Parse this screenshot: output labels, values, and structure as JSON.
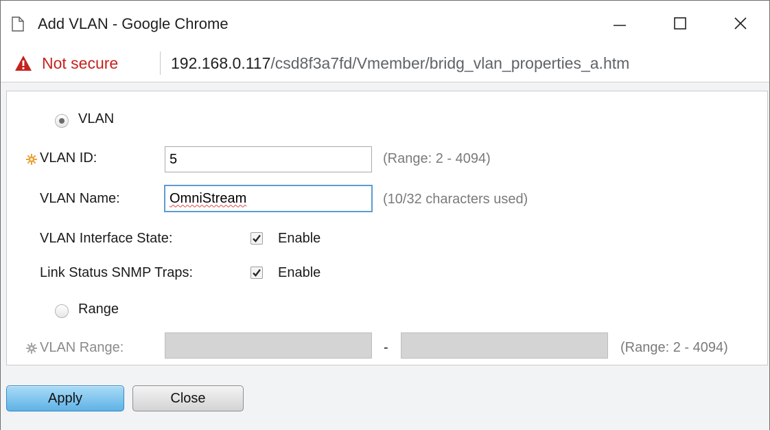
{
  "window": {
    "title": "Add VLAN - Google Chrome",
    "controls": {
      "minimize": "minimize-icon",
      "maximize": "maximize-icon",
      "close": "close-icon"
    }
  },
  "address": {
    "security_label": "Not secure",
    "url_host": "192.168.0.117",
    "url_path": "/csd8f3a7fd/Vmember/bridg_vlan_properties_a.htm"
  },
  "form": {
    "vlan_option": {
      "label": "VLAN",
      "selected": true
    },
    "vlan_id": {
      "label": "VLAN ID:",
      "value": "5",
      "hint": "(Range: 2 - 4094)",
      "required": true
    },
    "vlan_name": {
      "label": "VLAN Name:",
      "value": "OmniStream",
      "hint": "(10/32 characters used)"
    },
    "interface_state": {
      "label": "VLAN Interface State:",
      "checkbox_label": "Enable",
      "checked": true
    },
    "snmp_traps": {
      "label": "Link Status SNMP Traps:",
      "checkbox_label": "Enable",
      "checked": true
    },
    "range_option": {
      "label": "Range",
      "selected": false
    },
    "vlan_range": {
      "label": "VLAN Range:",
      "separator": "-",
      "from_value": "",
      "to_value": "",
      "hint": "(Range: 2 - 4094)",
      "disabled": true
    }
  },
  "buttons": {
    "apply": "Apply",
    "close": "Close"
  },
  "colors": {
    "accent": "#5fb2e6",
    "required_star": "#e8a33a",
    "warning": "#c5221f",
    "focus_border": "#5b9bd5"
  }
}
